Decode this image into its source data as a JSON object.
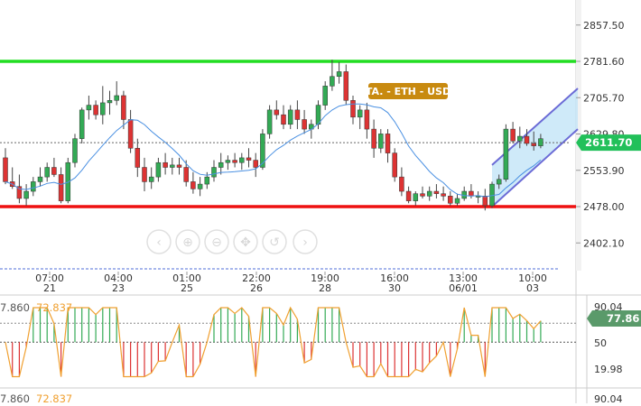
{
  "instrument_tag": "TA. - ETH - USD",
  "current_price_label": "2611.70",
  "price_axis": {
    "ticks": [
      "2857.50",
      "2781.60",
      "2705.70",
      "2629.80",
      "2553.90",
      "2478.00",
      "2402.10"
    ],
    "ylim": [
      2365,
      2885
    ]
  },
  "x_axis": {
    "times": [
      "07:00",
      "04:00",
      "01:00",
      "22:00",
      "19:00",
      "16:00",
      "13:00",
      "10:00"
    ],
    "days": [
      "21",
      "23",
      "25",
      "26",
      "28",
      "30",
      "06/01",
      "03"
    ]
  },
  "levels": {
    "resistance": 2781.6,
    "support": 2478.0,
    "dotted_current": 2611.7,
    "resistance_color": "#22dd22",
    "support_color": "#ee1111"
  },
  "colors": {
    "bull": "#33aa55",
    "bear": "#dd3333",
    "ma": "#4a90e2",
    "channel_fill": "#bfe3f7",
    "channel_line": "#6b6bd6",
    "tag_bg": "#c88a10",
    "price_badge": "#22c05a",
    "osc_line": "#f0a030",
    "osc_badge": "#5a9a6a"
  },
  "nav_icons": [
    "chevron-left-icon",
    "zoom-in-icon",
    "zoom-out-icon",
    "pan-icon",
    "reset-icon",
    "chevron-right-icon"
  ],
  "oscillator": {
    "values_label": [
      "7.860",
      "72.837"
    ],
    "axis_ticks": [
      "90.04",
      "50",
      "19.98"
    ],
    "current_label": "77.86",
    "ylim": [
      8,
      95
    ]
  },
  "oscillator2": {
    "values_label": [
      "7.860",
      "72.837"
    ],
    "axis_ticks": [
      "90.04"
    ]
  },
  "chart_data": {
    "type": "candlestick",
    "candles": [
      [
        2580,
        2600,
        2525,
        2530
      ],
      [
        2530,
        2560,
        2515,
        2520
      ],
      [
        2520,
        2545,
        2485,
        2495
      ],
      [
        2495,
        2525,
        2480,
        2510
      ],
      [
        2510,
        2540,
        2500,
        2530
      ],
      [
        2530,
        2560,
        2520,
        2540
      ],
      [
        2540,
        2570,
        2530,
        2560
      ],
      [
        2560,
        2580,
        2540,
        2545
      ],
      [
        2545,
        2560,
        2485,
        2490
      ],
      [
        2490,
        2580,
        2485,
        2570
      ],
      [
        2570,
        2630,
        2560,
        2620
      ],
      [
        2620,
        2685,
        2610,
        2680
      ],
      [
        2680,
        2710,
        2660,
        2690
      ],
      [
        2690,
        2700,
        2660,
        2670
      ],
      [
        2670,
        2730,
        2650,
        2695
      ],
      [
        2695,
        2720,
        2670,
        2700
      ],
      [
        2700,
        2740,
        2690,
        2710
      ],
      [
        2710,
        2720,
        2640,
        2660
      ],
      [
        2660,
        2680,
        2590,
        2600
      ],
      [
        2600,
        2620,
        2540,
        2560
      ],
      [
        2560,
        2580,
        2510,
        2530
      ],
      [
        2530,
        2560,
        2515,
        2540
      ],
      [
        2540,
        2580,
        2530,
        2570
      ],
      [
        2570,
        2590,
        2545,
        2560
      ],
      [
        2560,
        2580,
        2545,
        2565
      ],
      [
        2565,
        2580,
        2545,
        2560
      ],
      [
        2560,
        2575,
        2520,
        2530
      ],
      [
        2530,
        2550,
        2505,
        2515
      ],
      [
        2515,
        2540,
        2500,
        2525
      ],
      [
        2525,
        2550,
        2515,
        2540
      ],
      [
        2540,
        2575,
        2530,
        2560
      ],
      [
        2560,
        2590,
        2545,
        2570
      ],
      [
        2570,
        2585,
        2555,
        2575
      ],
      [
        2575,
        2590,
        2560,
        2570
      ],
      [
        2570,
        2590,
        2555,
        2580
      ],
      [
        2580,
        2600,
        2560,
        2575
      ],
      [
        2575,
        2590,
        2540,
        2560
      ],
      [
        2560,
        2640,
        2555,
        2630
      ],
      [
        2630,
        2690,
        2620,
        2680
      ],
      [
        2680,
        2700,
        2660,
        2670
      ],
      [
        2670,
        2690,
        2640,
        2650
      ],
      [
        2650,
        2690,
        2640,
        2680
      ],
      [
        2680,
        2700,
        2640,
        2660
      ],
      [
        2660,
        2680,
        2630,
        2640
      ],
      [
        2640,
        2660,
        2620,
        2650
      ],
      [
        2650,
        2700,
        2640,
        2690
      ],
      [
        2690,
        2740,
        2680,
        2730
      ],
      [
        2730,
        2785,
        2720,
        2750
      ],
      [
        2750,
        2780,
        2735,
        2760
      ],
      [
        2760,
        2775,
        2690,
        2700
      ],
      [
        2700,
        2710,
        2650,
        2665
      ],
      [
        2665,
        2690,
        2640,
        2680
      ],
      [
        2680,
        2695,
        2620,
        2640
      ],
      [
        2640,
        2660,
        2580,
        2600
      ],
      [
        2600,
        2640,
        2590,
        2630
      ],
      [
        2630,
        2640,
        2570,
        2590
      ],
      [
        2590,
        2600,
        2530,
        2540
      ],
      [
        2540,
        2560,
        2500,
        2510
      ],
      [
        2510,
        2520,
        2485,
        2490
      ],
      [
        2490,
        2510,
        2480,
        2505
      ],
      [
        2505,
        2520,
        2495,
        2500
      ],
      [
        2500,
        2520,
        2490,
        2510
      ],
      [
        2510,
        2525,
        2495,
        2505
      ],
      [
        2505,
        2520,
        2490,
        2500
      ],
      [
        2500,
        2510,
        2480,
        2485
      ],
      [
        2485,
        2505,
        2480,
        2495
      ],
      [
        2495,
        2520,
        2490,
        2510
      ],
      [
        2510,
        2525,
        2495,
        2500
      ],
      [
        2500,
        2510,
        2485,
        2500
      ],
      [
        2500,
        2515,
        2470,
        2480
      ],
      [
        2480,
        2530,
        2475,
        2525
      ],
      [
        2525,
        2545,
        2515,
        2535
      ],
      [
        2535,
        2650,
        2530,
        2640
      ],
      [
        2640,
        2655,
        2610,
        2615
      ],
      [
        2615,
        2645,
        2600,
        2625
      ],
      [
        2625,
        2640,
        2605,
        2610
      ],
      [
        2610,
        2635,
        2595,
        2605
      ],
      [
        2605,
        2630,
        2600,
        2620
      ]
    ]
  }
}
